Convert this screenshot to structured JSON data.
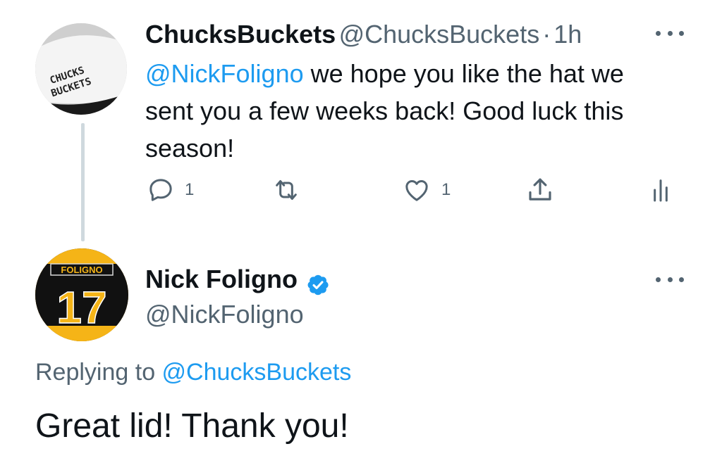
{
  "tweet1": {
    "display_name": "ChucksBuckets",
    "handle": "@ChucksBuckets",
    "separator": "·",
    "time": "1h",
    "mention": "@NickFoligno",
    "text_line1_rest": " we hope you like the hat we",
    "text_line2": "sent you a few weeks back! Good luck this",
    "text_line3": "season!",
    "avatar_text": "CHUCKS BUCKETS",
    "actions": {
      "reply_count": "1",
      "retweet_count": "",
      "like_count": "1"
    }
  },
  "tweet2": {
    "display_name": "Nick Foligno",
    "handle": "@NickFoligno",
    "verified": true,
    "avatar_name": "FOLIGNO",
    "avatar_number": "17",
    "replying_prefix": "Replying to ",
    "replying_to": "@ChucksBuckets",
    "text": "Great lid! Thank you!"
  },
  "colors": {
    "accent": "#1d9bf0",
    "secondary_text": "#536471",
    "thread_line": "#cfd9de",
    "jersey_gold": "#f5b417"
  },
  "icons": [
    "more-icon",
    "reply-icon",
    "retweet-icon",
    "like-icon",
    "share-icon",
    "analytics-icon",
    "verified-badge-icon"
  ]
}
